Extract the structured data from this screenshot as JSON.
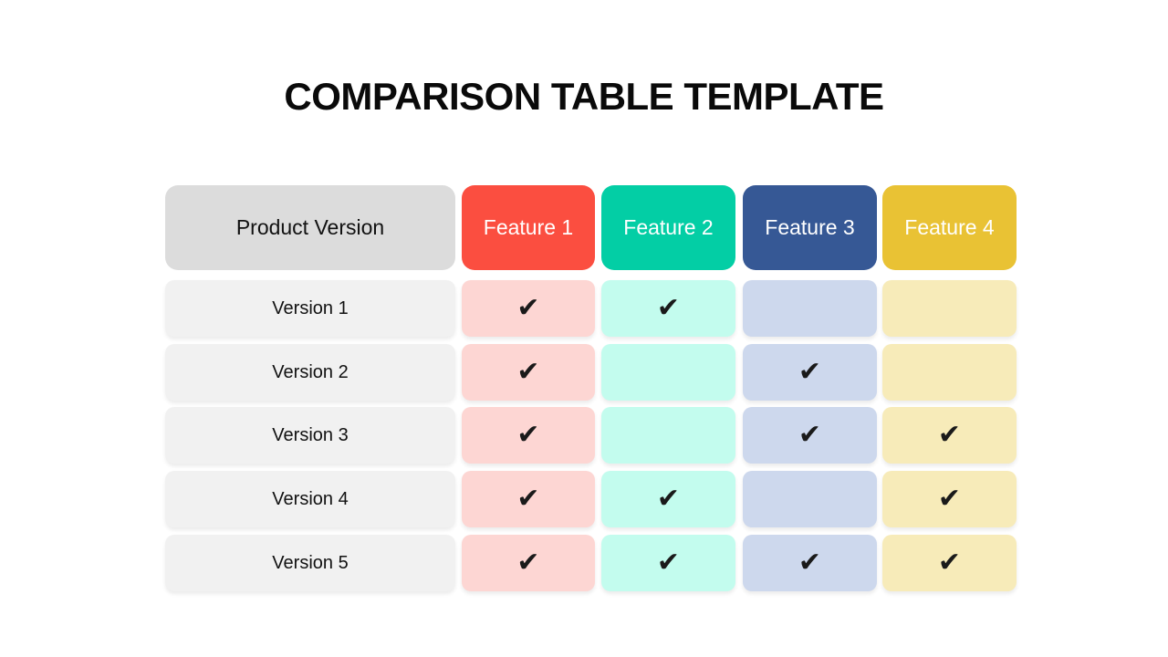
{
  "title": "COMPARISON TABLE TEMPLATE",
  "table": {
    "header_label": "Product Version",
    "features": [
      {
        "label": "Feature 1",
        "color": "#fb4e40",
        "light": "#fdd6d3"
      },
      {
        "label": "Feature 2",
        "color": "#03cea5",
        "light": "#c3fcee"
      },
      {
        "label": "Feature 3",
        "color": "#365895",
        "light": "#cdd8ed"
      },
      {
        "label": "Feature 4",
        "color": "#e9c234",
        "light": "#f7ebb9"
      }
    ],
    "rows": [
      {
        "label": "Version 1",
        "checks": [
          true,
          true,
          false,
          false
        ]
      },
      {
        "label": "Version 2",
        "checks": [
          true,
          false,
          true,
          false
        ]
      },
      {
        "label": "Version 3",
        "checks": [
          true,
          false,
          true,
          true
        ]
      },
      {
        "label": "Version 4",
        "checks": [
          true,
          true,
          false,
          true
        ]
      },
      {
        "label": "Version 5",
        "checks": [
          true,
          true,
          true,
          true
        ]
      }
    ],
    "check_glyph": "✔"
  }
}
